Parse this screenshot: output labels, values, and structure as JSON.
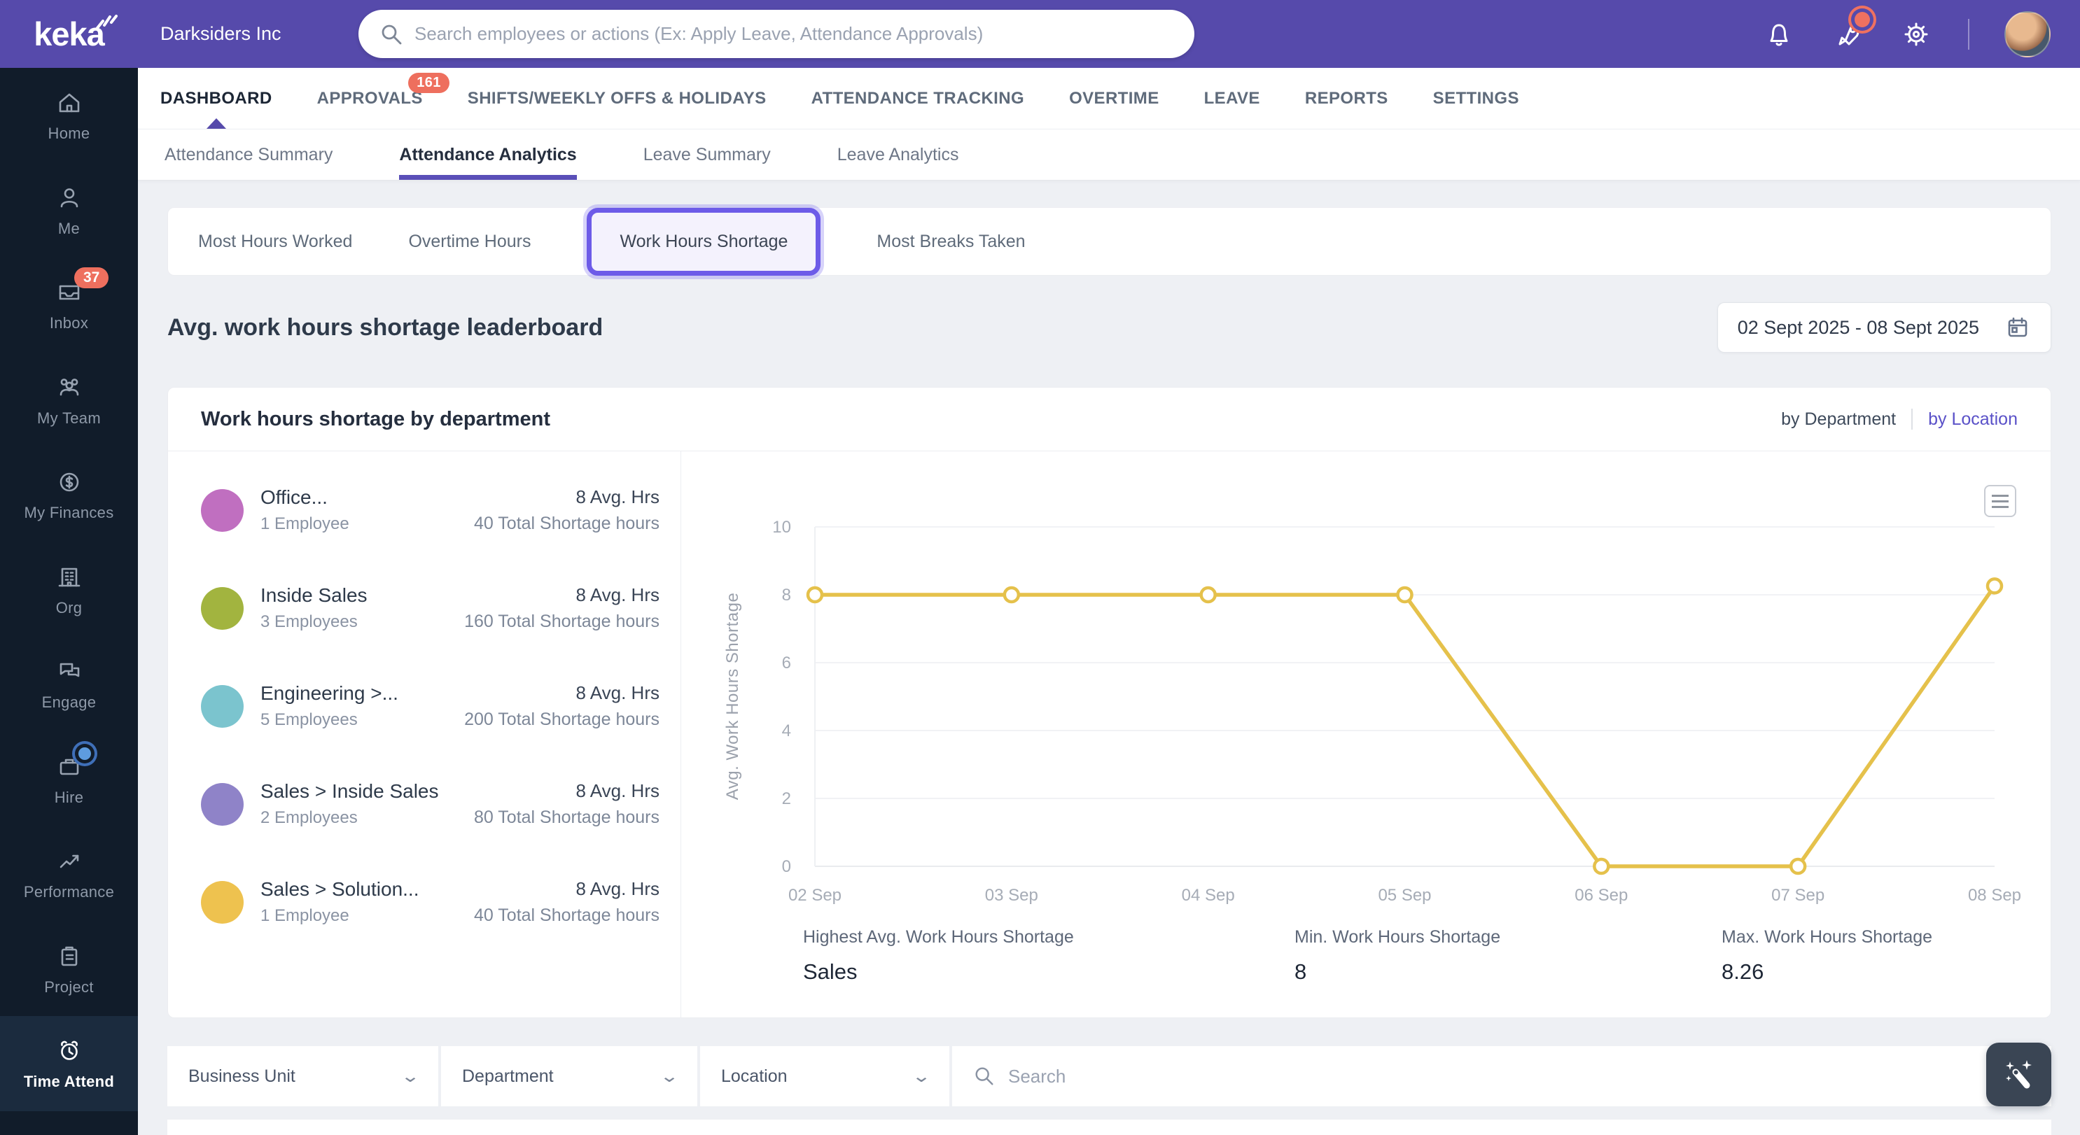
{
  "topbar": {
    "brand": "keka",
    "company": "Darksiders Inc",
    "search_placeholder": "Search employees or actions (Ex: Apply Leave, Attendance Approvals)"
  },
  "sidebar": {
    "items": [
      {
        "label": "Home"
      },
      {
        "label": "Me"
      },
      {
        "label": "Inbox",
        "badge": "37"
      },
      {
        "label": "My Team"
      },
      {
        "label": "My Finances"
      },
      {
        "label": "Org"
      },
      {
        "label": "Engage"
      },
      {
        "label": "Hire"
      },
      {
        "label": "Performance"
      },
      {
        "label": "Project"
      },
      {
        "label": "Time Attend"
      }
    ]
  },
  "nav": {
    "items": [
      {
        "label": "DASHBOARD"
      },
      {
        "label": "APPROVALS",
        "badge": "161"
      },
      {
        "label": "SHIFTS/WEEKLY OFFS & HOLIDAYS"
      },
      {
        "label": "ATTENDANCE TRACKING"
      },
      {
        "label": "OVERTIME"
      },
      {
        "label": "LEAVE"
      },
      {
        "label": "REPORTS"
      },
      {
        "label": "SETTINGS"
      }
    ]
  },
  "subtabs": {
    "items": [
      "Attendance Summary",
      "Attendance Analytics",
      "Leave Summary",
      "Leave Analytics"
    ]
  },
  "analytics_tabs": {
    "items": [
      "Most Hours Worked",
      "Overtime Hours",
      "Work Hours Shortage",
      "Most Breaks Taken"
    ]
  },
  "page": {
    "heading": "Avg. work hours shortage leaderboard",
    "date_range": "02 Sept 2025 - 08 Sept 2025"
  },
  "card": {
    "title": "Work hours shortage by department",
    "toggle_department": "by Department",
    "toggle_location": "by Location"
  },
  "leaderboard": {
    "items": [
      {
        "name": "Office...",
        "employees": "1 Employee",
        "avg": "8 Avg. Hrs",
        "total": "40 Total Shortage hours",
        "color": "#C06FC0"
      },
      {
        "name": "Inside Sales",
        "employees": "3 Employees",
        "avg": "8 Avg. Hrs",
        "total": "160 Total Shortage hours",
        "color": "#A2B43F"
      },
      {
        "name": "Engineering >...",
        "employees": "5 Employees",
        "avg": "8 Avg. Hrs",
        "total": "200 Total Shortage hours",
        "color": "#7BC4CE"
      },
      {
        "name": "Sales > Inside Sales",
        "employees": "2 Employees",
        "avg": "8 Avg. Hrs",
        "total": "80 Total Shortage hours",
        "color": "#8F83C8"
      },
      {
        "name": "Sales > Solution...",
        "employees": "1 Employee",
        "avg": "8 Avg. Hrs",
        "total": "40 Total Shortage hours",
        "color": "#EEC24F"
      }
    ]
  },
  "chart_data": {
    "type": "line",
    "x": [
      "02 Sep",
      "03 Sep",
      "04 Sep",
      "05 Sep",
      "06 Sep",
      "07 Sep",
      "08 Sep"
    ],
    "values": [
      8,
      8,
      8,
      8,
      0,
      0,
      8.26
    ],
    "yticks": [
      0,
      2,
      4,
      6,
      8,
      10
    ],
    "ylim": [
      0,
      10
    ],
    "ylabel": "Avg. Work Hours Shortage",
    "line_color": "#E5C14B",
    "grid": true,
    "legend": false
  },
  "stats": {
    "items": [
      {
        "label": "Highest Avg. Work Hours Shortage",
        "value": "Sales"
      },
      {
        "label": "Min. Work Hours Shortage",
        "value": "8"
      },
      {
        "label": "Max. Work Hours Shortage",
        "value": "8.26"
      }
    ]
  },
  "filters": {
    "business_unit": "Business Unit",
    "department": "Department",
    "location": "Location",
    "search_placeholder": "Search"
  },
  "colors": {
    "accent_purple": "#564AAB",
    "highlight_purple": "#6D5BE8",
    "badge_salmon": "#EE6F5E",
    "sidebar_dark": "#111C2A"
  }
}
